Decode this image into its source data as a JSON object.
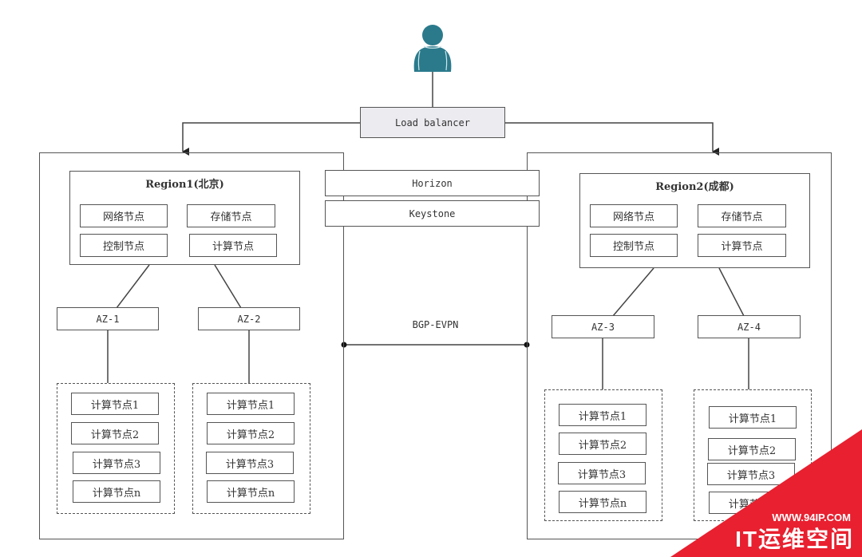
{
  "user": {
    "icon": "user-icon",
    "color": "#2a7a8c"
  },
  "load_balancer": "Load balancer",
  "shared_services": [
    "Horizon",
    "Keystone"
  ],
  "interconnect": "BGP-EVPN",
  "regions": [
    {
      "title": "Region1(北京)",
      "nodes": [
        "网络节点",
        "存储节点",
        "控制节点",
        "计算节点"
      ],
      "azs": [
        {
          "name": "AZ-1",
          "compute": [
            "计算节点1",
            "计算节点2",
            "计算节点3",
            "计算节点n"
          ]
        },
        {
          "name": "AZ-2",
          "compute": [
            "计算节点1",
            "计算节点2",
            "计算节点3",
            "计算节点n"
          ]
        }
      ]
    },
    {
      "title": "Region2(成都)",
      "nodes": [
        "网络节点",
        "存储节点",
        "控制节点",
        "计算节点"
      ],
      "azs": [
        {
          "name": "AZ-3",
          "compute": [
            "计算节点1",
            "计算节点2",
            "计算节点3",
            "计算节点n"
          ]
        },
        {
          "name": "AZ-4",
          "compute": [
            "计算节点1",
            "计算节点2",
            "计算节点3",
            "计算节点n"
          ]
        }
      ]
    }
  ],
  "watermark": {
    "url": "WWW.94IP.COM",
    "name": "IT运维空间",
    "color": "#e8202f"
  }
}
